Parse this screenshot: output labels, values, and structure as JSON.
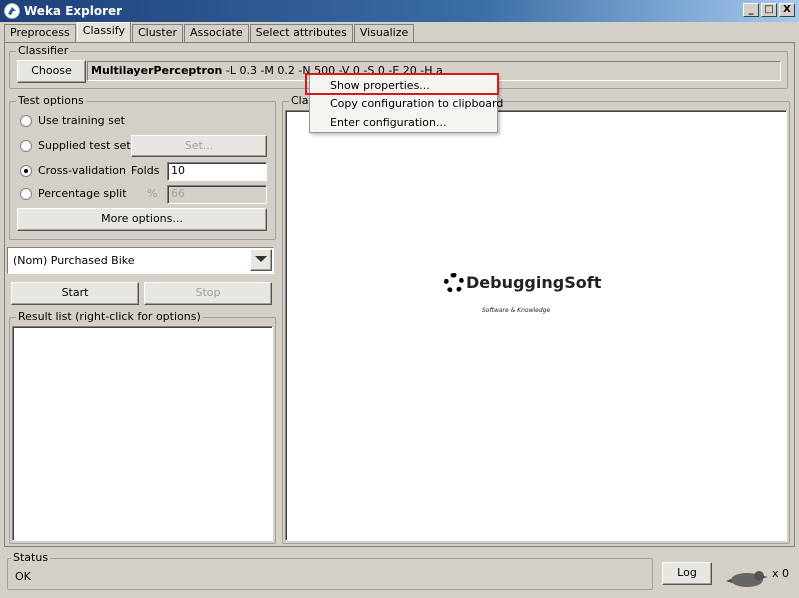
{
  "window": {
    "title": "Weka Explorer",
    "buttons": {
      "minimize": "_",
      "maximize": "□",
      "close": "X"
    }
  },
  "tabs": [
    "Preprocess",
    "Classify",
    "Cluster",
    "Associate",
    "Select attributes",
    "Visualize"
  ],
  "active_tab": "Classify",
  "classifier": {
    "legend": "Classifier",
    "choose_label": "Choose",
    "name": "MultilayerPerceptron",
    "options": " -L 0.3 -M 0.2 -N 500 -V 0 -S 0 -E 20 -H a"
  },
  "test_options": {
    "legend": "Test options",
    "use_training": "Use training set",
    "supplied_test": "Supplied test set",
    "set_label": "Set...",
    "cross_validation": "Cross-validation",
    "folds_label": "Folds",
    "folds_value": "10",
    "percentage_split": "Percentage split",
    "percent_sign": "%",
    "percent_value": "66",
    "more_options": "More options...",
    "selected": "cross_validation"
  },
  "class_attribute": {
    "value": "(Nom) Purchased Bike"
  },
  "actions": {
    "start": "Start",
    "stop": "Stop"
  },
  "result_list": {
    "legend": "Result list (right-click for options)"
  },
  "output": {
    "legend": "Classifier output",
    "legend_visible": "Class",
    "watermark_text": "DebuggingSoft",
    "watermark_sub": "Software & Knowledge"
  },
  "context_menu": {
    "items": [
      "Show properties...",
      "Copy configuration to clipboard",
      "Enter configuration..."
    ],
    "highlight_color": "#d51a1a"
  },
  "status": {
    "legend": "Status",
    "text": "OK",
    "log_label": "Log",
    "count": "x 0"
  }
}
